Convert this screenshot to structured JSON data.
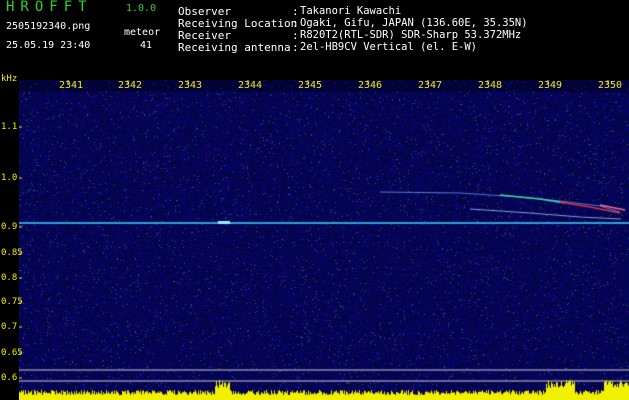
{
  "header": {
    "app_title": "HROFFT",
    "version": "1.0.0",
    "file_name": "2505192340.png",
    "datetime": "25.05.19 23:40",
    "meteor_label": "meteor",
    "meteor_count": "41"
  },
  "station": [
    {
      "label": "Observer",
      "value": "Takanori Kawachi"
    },
    {
      "label": "Receiving Location",
      "value": "Ogaki, Gifu, JAPAN (136.60E, 35.35N)"
    },
    {
      "label": "Receiver",
      "value": "R820T2(RTL-SDR) SDR-Sharp 53.372MHz"
    },
    {
      "label": "Receiving antenna",
      "value": "2el-HB9CV Vertical (el. E-W)"
    }
  ],
  "axes": {
    "y_unit": "kHz",
    "y_ticks": [
      "1.1",
      "1.0",
      "0.9",
      "0.85",
      "0.8",
      "0.75",
      "0.7",
      "0.65",
      "0.6"
    ],
    "x_ticks": [
      "2341",
      "2342",
      "2343",
      "2344",
      "2345",
      "2346",
      "2347",
      "2348",
      "2349",
      "2350"
    ]
  },
  "colors": {
    "background": "#000000",
    "plot_noise": "#0a0a6e",
    "carrier": "#3ad6ff",
    "activity": "#f0f000",
    "text_green": "#2fd12f",
    "tick_yellow": "#f0f000"
  }
}
